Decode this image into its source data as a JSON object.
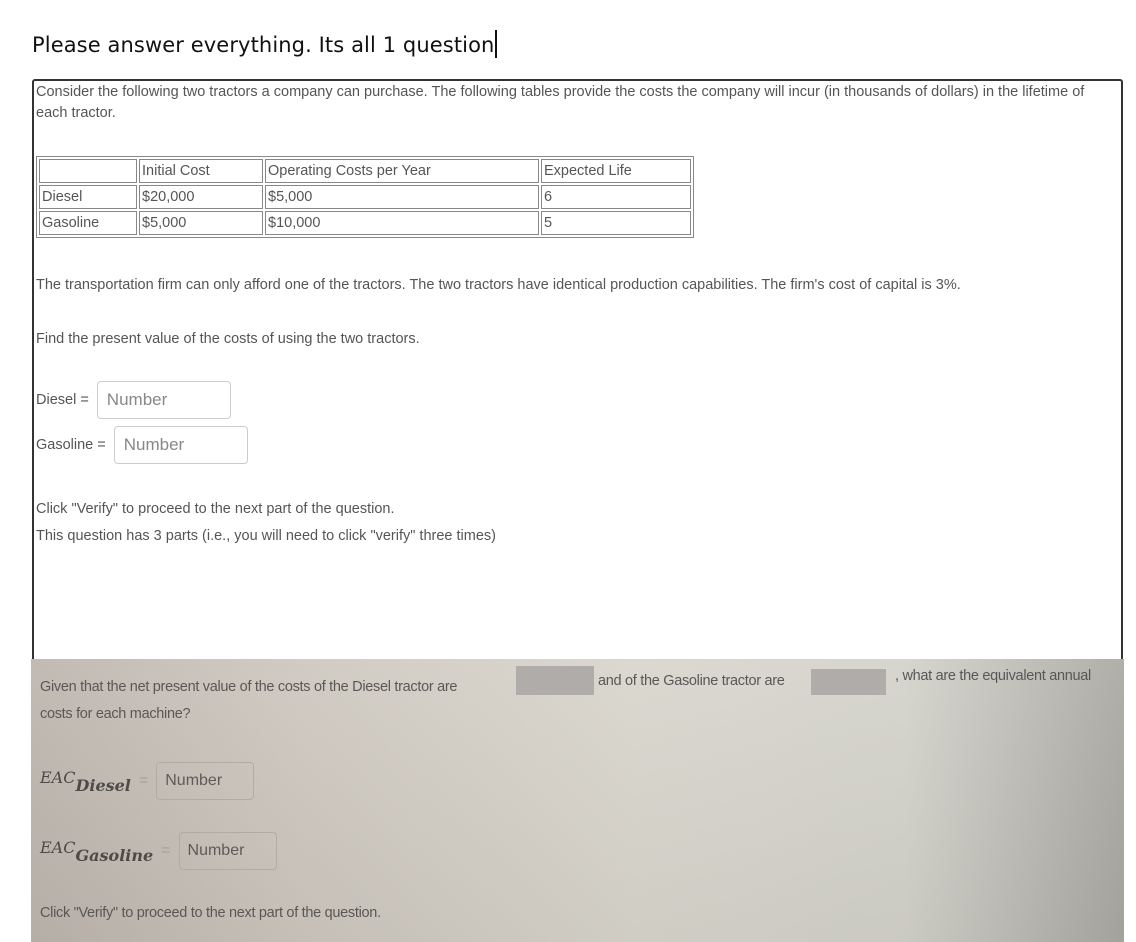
{
  "heading": "Please answer everything. Its all 1 question",
  "part1": {
    "intro": "Consider the following two tractors a company can purchase. The following tables provide the costs the company will incur (in thousands of dollars) in the lifetime of each tractor.",
    "table": {
      "headers": [
        "",
        "Initial Cost",
        "Operating Costs per Year",
        "Expected Life"
      ],
      "rows": [
        [
          "Diesel",
          "$20,000",
          "$5,000",
          "6"
        ],
        [
          "Gasoline",
          "$5,000",
          "$10,000",
          "5"
        ]
      ]
    },
    "firm_text": "The transportation firm can only afford one of the tractors. The two tractors have identical production capabilities. The firm's cost of capital is 3%.",
    "find_text": "Find the present value of the costs of using the two tractors.",
    "fields": [
      {
        "label": "Diesel =",
        "placeholder": "Number",
        "value": ""
      },
      {
        "label": "Gasoline =",
        "placeholder": "Number",
        "value": ""
      }
    ],
    "verify_text": "Click \"Verify\" to proceed to the next part of the question.",
    "parts_text": "This question has 3 parts (i.e., you will need to click \"verify\" three times)"
  },
  "part2": {
    "q_a": "Given that the net present value of the costs of the Diesel tractor are",
    "q_b": "and of the Gasoline tractor are",
    "q_c": ", what are the equivalent annual",
    "q_d": "costs for each machine?",
    "eac_diesel": {
      "label": "EAC",
      "sub": "Diesel",
      "eq": "=",
      "placeholder": "Number"
    },
    "eac_gasoline": {
      "label": "EAC",
      "sub": "Gasoline",
      "eq": "=",
      "placeholder": "Number"
    },
    "verify_text": "Click \"Verify\" to proceed to the next part of the question."
  }
}
